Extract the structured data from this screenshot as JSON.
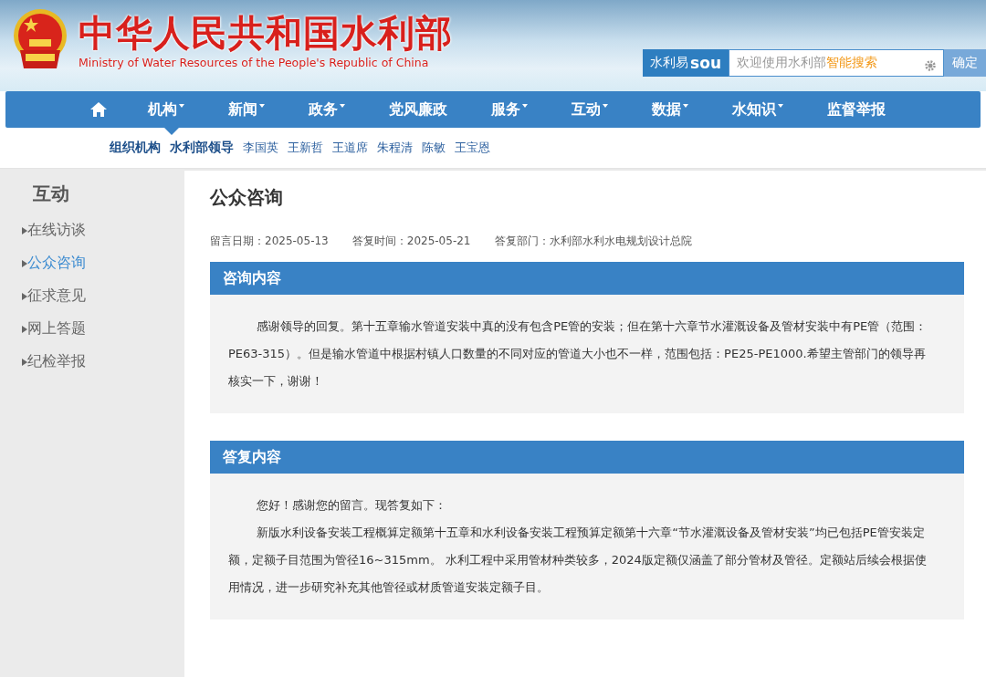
{
  "header": {
    "title": "中华人民共和国水利部",
    "subtitle": "Ministry of Water Resources of the People's Republic of China",
    "search": {
      "brand": "水利易",
      "brand_latin": "sou",
      "placeholder_plain": "欢迎使用水利部",
      "placeholder_highlight": "智能搜索",
      "button": "确定"
    }
  },
  "nav": {
    "items": [
      {
        "label": "机构",
        "dropdown": true,
        "selected": true
      },
      {
        "label": "新闻",
        "dropdown": true,
        "selected": false
      },
      {
        "label": "政务",
        "dropdown": true,
        "selected": false
      },
      {
        "label": "党风廉政",
        "dropdown": false,
        "selected": false
      },
      {
        "label": "服务",
        "dropdown": true,
        "selected": false
      },
      {
        "label": "互动",
        "dropdown": true,
        "selected": false
      },
      {
        "label": "数据",
        "dropdown": true,
        "selected": false
      },
      {
        "label": "水知识",
        "dropdown": true,
        "selected": false
      },
      {
        "label": "监督举报",
        "dropdown": false,
        "selected": false
      }
    ]
  },
  "subnav": {
    "section": "组织机构",
    "items": [
      {
        "label": "水利部领导",
        "selected": true
      },
      {
        "label": "李国英",
        "selected": false
      },
      {
        "label": "王新哲",
        "selected": false
      },
      {
        "label": "王道席",
        "selected": false
      },
      {
        "label": "朱程清",
        "selected": false
      },
      {
        "label": "陈敏",
        "selected": false
      },
      {
        "label": "王宝恩",
        "selected": false
      }
    ]
  },
  "sidebar": {
    "title": "互动",
    "items": [
      {
        "label": "在线访谈",
        "selected": false
      },
      {
        "label": "公众咨询",
        "selected": true
      },
      {
        "label": "征求意见",
        "selected": false
      },
      {
        "label": "网上答题",
        "selected": false
      },
      {
        "label": "纪检举报",
        "selected": false
      }
    ]
  },
  "main": {
    "title": "公众咨询",
    "meta": [
      "留言日期：2025-05-13",
      "答复时间：2025-05-21",
      "答复部门：水利部水利水电规划设计总院"
    ],
    "sections": [
      {
        "heading": "咨询内容",
        "paragraphs": [
          "感谢领导的回复。第十五章输水管道安装中真的没有包含PE管的安装；但在第十六章节水灌溉设备及管材安装中有PE管（范围：PE63-315）。但是输水管道中根据村镇人口数量的不同对应的管道大小也不一样，范围包括：PE25-PE1000.希望主管部门的领导再核实一下，谢谢！"
        ]
      },
      {
        "heading": "答复内容",
        "paragraphs": [
          "您好！感谢您的留言。现答复如下：",
          "新版水利设备安装工程概算定额第十五章和水利设备安装工程预算定额第十六章“节水灌溉设备及管材安装”均已包括PE管安装定额，定额子目范围为管径16~315mm。 水利工程中采用管材种类较多，2024版定额仅涵盖了部分管材及管径。定额站后续会根据使用情况，进一步研究补充其他管径或材质管道安装定额子目。"
        ]
      }
    ]
  }
}
